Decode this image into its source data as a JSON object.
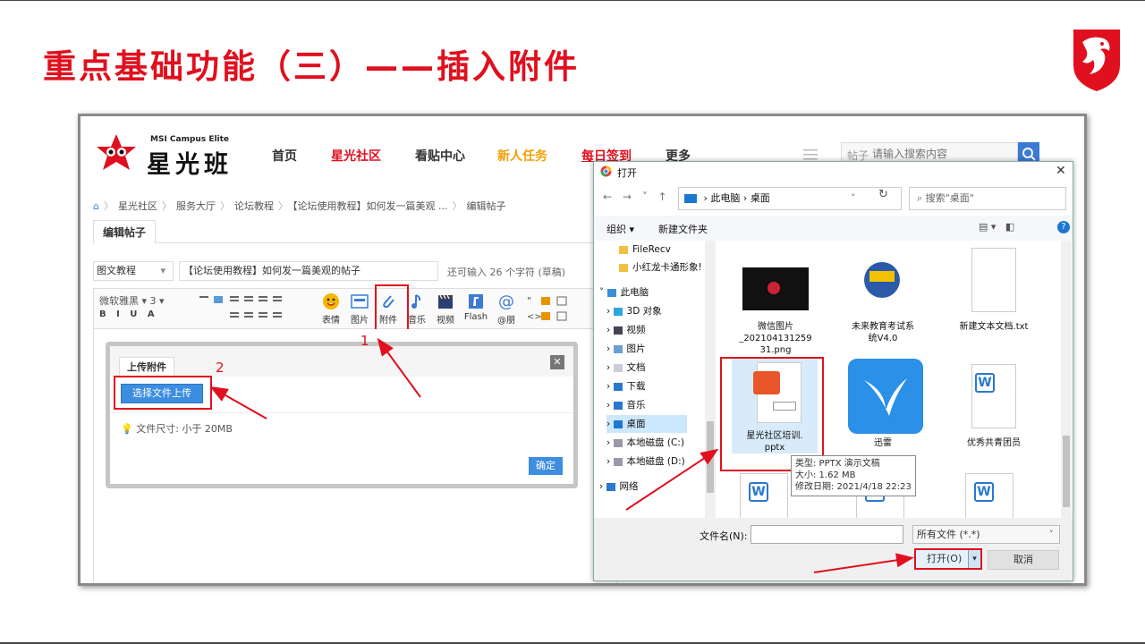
{
  "slide": {
    "title": "重点基础功能（三）——插入附件"
  },
  "forum": {
    "brand_en": "MSI Campus Elite",
    "brand_cn": "星光班",
    "nav": [
      "首页",
      "星光社区",
      "看贴中心",
      "新人任务",
      "每日签到",
      "更多"
    ],
    "search_category": "帖子",
    "search_placeholder": "请输入搜索内容",
    "breadcrumb": [
      "星光社区",
      "服务大厅",
      "论坛教程",
      "【论坛使用教程】如何发一篇美观 ...",
      "编辑帖子"
    ],
    "tab_edit": "编辑帖子",
    "category": "图文教程",
    "post_title": "【论坛使用教程】如何发一篇美观的帖子",
    "char_note": "还可输入 26 个字符 (草稿)",
    "toolbar": {
      "font": "微软雅黑 ▾  3  ▾",
      "format_row": "B I U A",
      "buttons": [
        "表情",
        "图片",
        "附件",
        "音乐",
        "视频",
        "Flash",
        "@朋"
      ]
    },
    "upload": {
      "tab": "上传附件",
      "choose_button": "选择文件上传",
      "file_size": "文件尺寸: 小于 20MB",
      "confirm": "确定"
    }
  },
  "annotations": {
    "num1": "1",
    "num2": "2"
  },
  "open_dialog": {
    "title": "打开",
    "path": [
      "此电脑",
      "桌面"
    ],
    "search_placeholder": "搜索\"桌面\"",
    "organize": "组织 ▾",
    "new_folder": "新建文件夹",
    "tree": [
      {
        "label": "FileRecv",
        "icon": "folder-icon"
      },
      {
        "label": "小红龙卡通形象!",
        "icon": "folder-icon"
      },
      {
        "label": "此电脑",
        "icon": "computer-icon"
      },
      {
        "label": "3D 对象",
        "icon": "cube-icon"
      },
      {
        "label": "视频",
        "icon": "video-icon"
      },
      {
        "label": "图片",
        "icon": "picture-icon"
      },
      {
        "label": "文档",
        "icon": "document-icon"
      },
      {
        "label": "下载",
        "icon": "download-icon"
      },
      {
        "label": "音乐",
        "icon": "music-icon"
      },
      {
        "label": "桌面",
        "icon": "desktop-icon"
      },
      {
        "label": "本地磁盘 (C:)",
        "icon": "drive-icon"
      },
      {
        "label": "本地磁盘 (D:)",
        "icon": "drive-icon"
      },
      {
        "label": "网络",
        "icon": "network-icon"
      }
    ],
    "files": [
      {
        "name": "微信图片_20210413125931.png",
        "lines": [
          "微信图片",
          "_202104131259",
          "31.png"
        ]
      },
      {
        "name": "未来教育考试系统V4.0",
        "lines": [
          "未来教育考试系",
          "统V4.0"
        ]
      },
      {
        "name": "新建文本文档.txt",
        "lines": [
          "新建文本文档.txt"
        ]
      },
      {
        "name": "星光社区培训.pptx",
        "lines": [
          "星光社区培训.",
          "pptx"
        ]
      },
      {
        "name": "迅雷",
        "lines": [
          "迅雷"
        ]
      },
      {
        "name": "优秀共青团员",
        "lines": [
          "优秀共青团员"
        ]
      }
    ],
    "tooltip": [
      "类型: PPTX 演示文稿",
      "大小: 1.62 MB",
      "修改日期: 2021/4/18 22:23"
    ],
    "filename_label": "文件名(N):",
    "filename_value": "",
    "file_type": "所有文件 (*.*)",
    "open_button": "打开(O)",
    "cancel_button": "取消"
  },
  "colors": {
    "brand_red": "#e0101e",
    "link_blue": "#3d8de0",
    "nav_orange": "#f2a007"
  }
}
